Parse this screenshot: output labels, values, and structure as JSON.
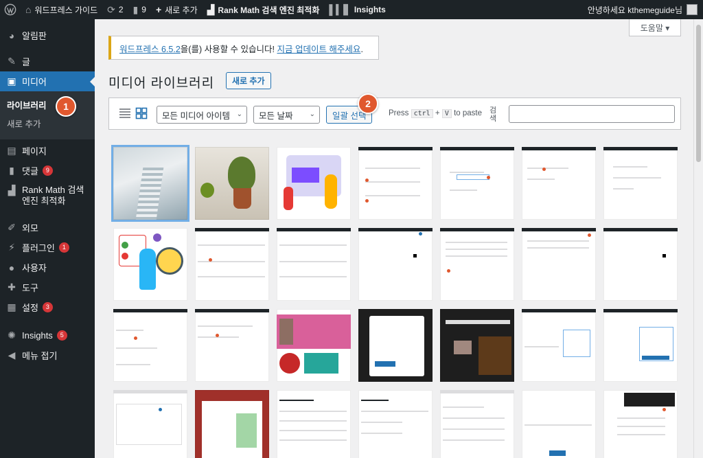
{
  "adminbar": {
    "site_name": "워드프레스 가이드",
    "updates_count": "2",
    "comments_count": "9",
    "new_label": "새로 추가",
    "rankmath_label": "Rank Math 검색 엔진 최적화",
    "insights_label": "Insights",
    "greeting": "안녕하세요 kthemeguide님"
  },
  "sidebar": {
    "items": [
      {
        "label": "알림판",
        "icon": "dashboard-icon"
      },
      {
        "label": "글",
        "icon": "pin-icon"
      },
      {
        "label": "미디어",
        "icon": "media-icon"
      },
      {
        "label": "페이지",
        "icon": "page-icon"
      },
      {
        "label": "댓글",
        "icon": "comment-icon",
        "badge": "9"
      },
      {
        "label": "Rank Math 검색 엔진 최적화",
        "icon": "rankmath-icon"
      },
      {
        "label": "외모",
        "icon": "brush-icon"
      },
      {
        "label": "플러그인",
        "icon": "plugin-icon",
        "badge": "1"
      },
      {
        "label": "사용자",
        "icon": "user-icon"
      },
      {
        "label": "도구",
        "icon": "wrench-icon"
      },
      {
        "label": "설정",
        "icon": "settings-icon",
        "badge": "3"
      },
      {
        "label": "Insights",
        "icon": "insights-icon",
        "badge": "5"
      },
      {
        "label": "메뉴 접기",
        "icon": "collapse-icon"
      }
    ],
    "media_submenu": {
      "library": "라이브러리",
      "add_new": "새로 추가"
    }
  },
  "steps": {
    "one": "1",
    "two": "2"
  },
  "help_tab": "도움말 ▾",
  "notice": {
    "version_link": "워드프레스 6.5.2",
    "text_mid": "을(를) 사용할 수 있습니다! ",
    "update_link": "지금 업데이트 해주세요",
    "text_end": "."
  },
  "page": {
    "title": "미디어 라이브러리",
    "add_new": "새로 추가"
  },
  "toolbar": {
    "filter_type": "모든 미디어 아이템",
    "filter_date": "모든 날짜",
    "bulk_select": "일괄 선택",
    "paste_press": "Press",
    "paste_key1": "ctrl",
    "paste_plus": "+",
    "paste_key2": "V",
    "paste_to": "to paste",
    "search_label": "검색",
    "search_value": ""
  },
  "colors": {
    "accent": "#2271b1",
    "sidebar": "#1d2327",
    "badge": "#d63638",
    "step": "#e0582e",
    "notice": "#dba617"
  }
}
